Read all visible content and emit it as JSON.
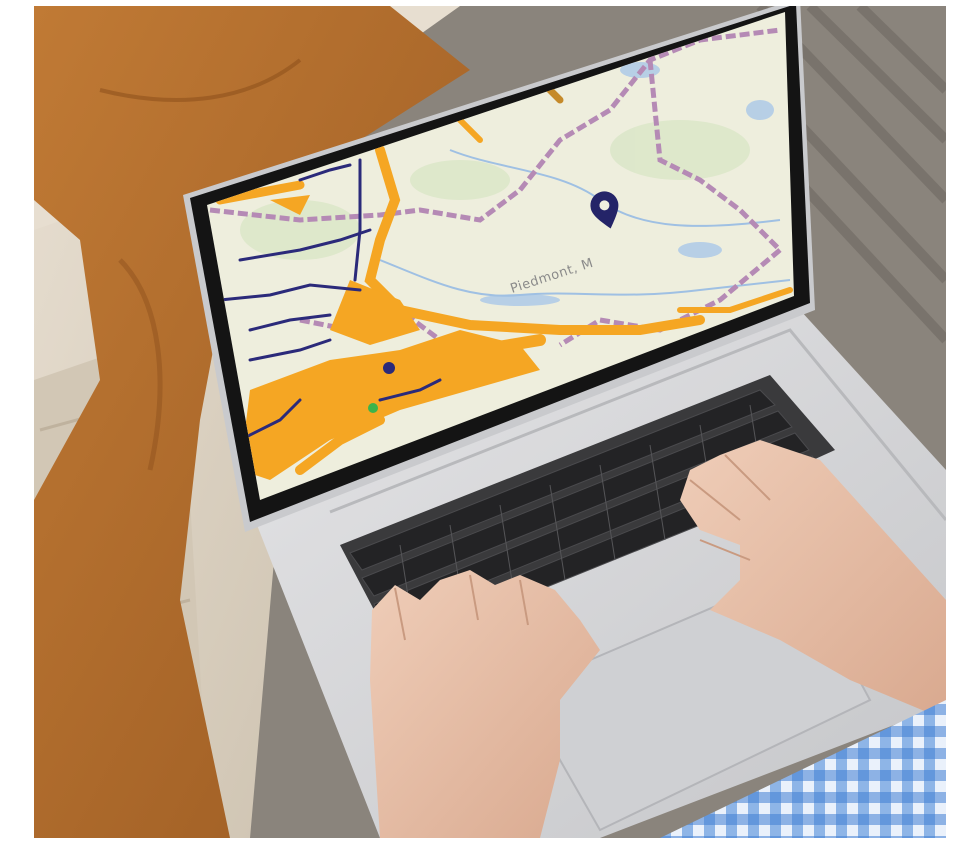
{
  "scene": {
    "description_colors": {
      "background": "#ffffff",
      "couch": "#dcd3c4",
      "floor": "#7d7770",
      "pants": "#b06b2a",
      "laptop_body": "#d6d6d8",
      "laptop_bezel": "#141414",
      "map_land": "#f0f0e0",
      "map_orange_roads": "#f5a623",
      "map_blue_roads": "#2b2a7a",
      "map_boundary": "#b58ab5",
      "map_water": "#a9c7e8",
      "pin": "#242468",
      "skin": "#e7c0aa",
      "shirt": "#4a86d6"
    }
  },
  "map": {
    "place_label": "Piedmont, M",
    "pin_icon": "location-pin-icon"
  }
}
